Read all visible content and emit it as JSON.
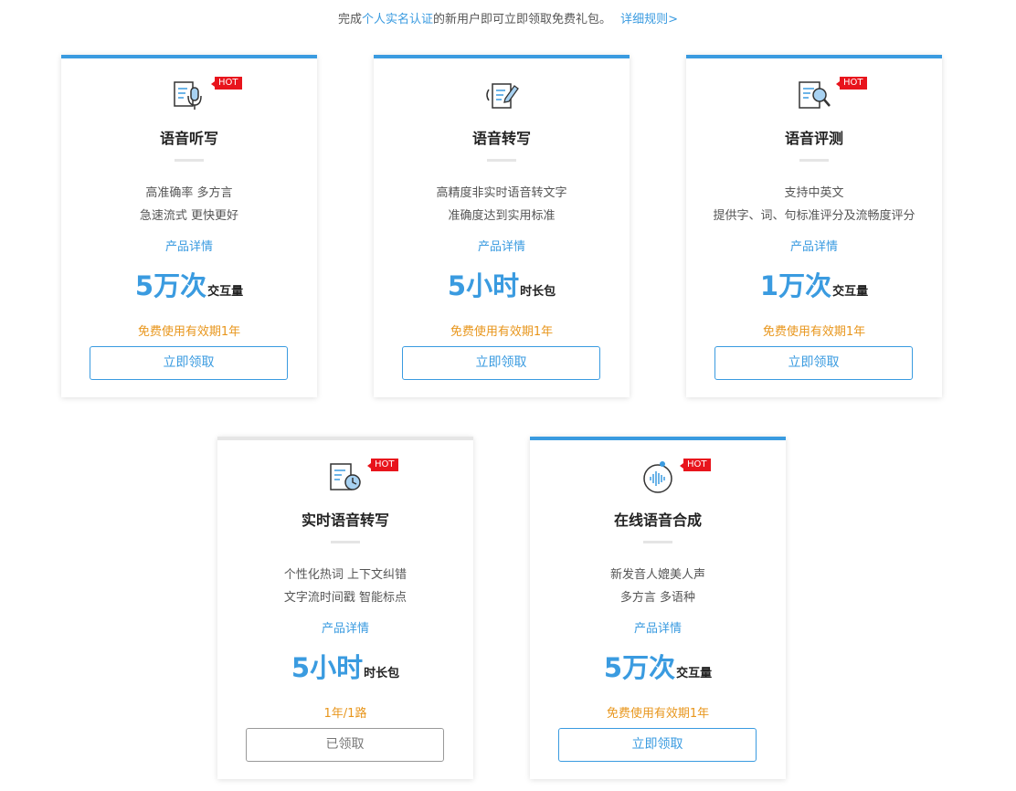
{
  "intro": {
    "prefix": "完成",
    "highlight": "个人实名认证",
    "suffix": "的新用户即可立即领取免费礼包。",
    "rules_link": "详细规则>"
  },
  "colors": {
    "accent": "#3a9be0",
    "hot": "#e8141c",
    "validity": "#e8961c"
  },
  "cards": [
    {
      "icon": "voice-dictation-icon",
      "hot": "HOT",
      "title": "语音听写",
      "desc1": "高准确率 多方言",
      "desc2": "急速流式 更快更好",
      "link": "产品详情",
      "amount": "5万次",
      "unit": "交互量",
      "validity": "免费使用有效期1年",
      "button": "立即领取"
    },
    {
      "icon": "voice-transcription-icon",
      "title": "语音转写",
      "desc1": "高精度非实时语音转文字",
      "desc2": "准确度达到实用标准",
      "link": "产品详情",
      "amount": "5小时",
      "unit": "时长包",
      "validity": "免费使用有效期1年",
      "button": "立即领取"
    },
    {
      "icon": "speech-evaluation-icon",
      "hot": "HOT",
      "title": "语音评测",
      "desc1": "支持中英文",
      "desc2": "提供字、词、句标准评分及流畅度评分",
      "link": "产品详情",
      "amount": "1万次",
      "unit": "交互量",
      "validity": "免费使用有效期1年",
      "button": "立即领取"
    },
    {
      "icon": "realtime-transcription-icon",
      "hot": "HOT",
      "title": "实时语音转写",
      "desc1": "个性化热词 上下文纠错",
      "desc2": "文字流时间戳 智能标点",
      "link": "产品详情",
      "amount": "5小时",
      "unit": "时长包",
      "validity": "1年/1路",
      "button": "已领取"
    },
    {
      "icon": "speech-synthesis-icon",
      "hot": "HOT",
      "title": "在线语音合成",
      "desc1": "新发音人媲美人声",
      "desc2": "多方言 多语种",
      "link": "产品详情",
      "amount": "5万次",
      "unit": "交互量",
      "validity": "免费使用有效期1年",
      "button": "立即领取"
    }
  ]
}
